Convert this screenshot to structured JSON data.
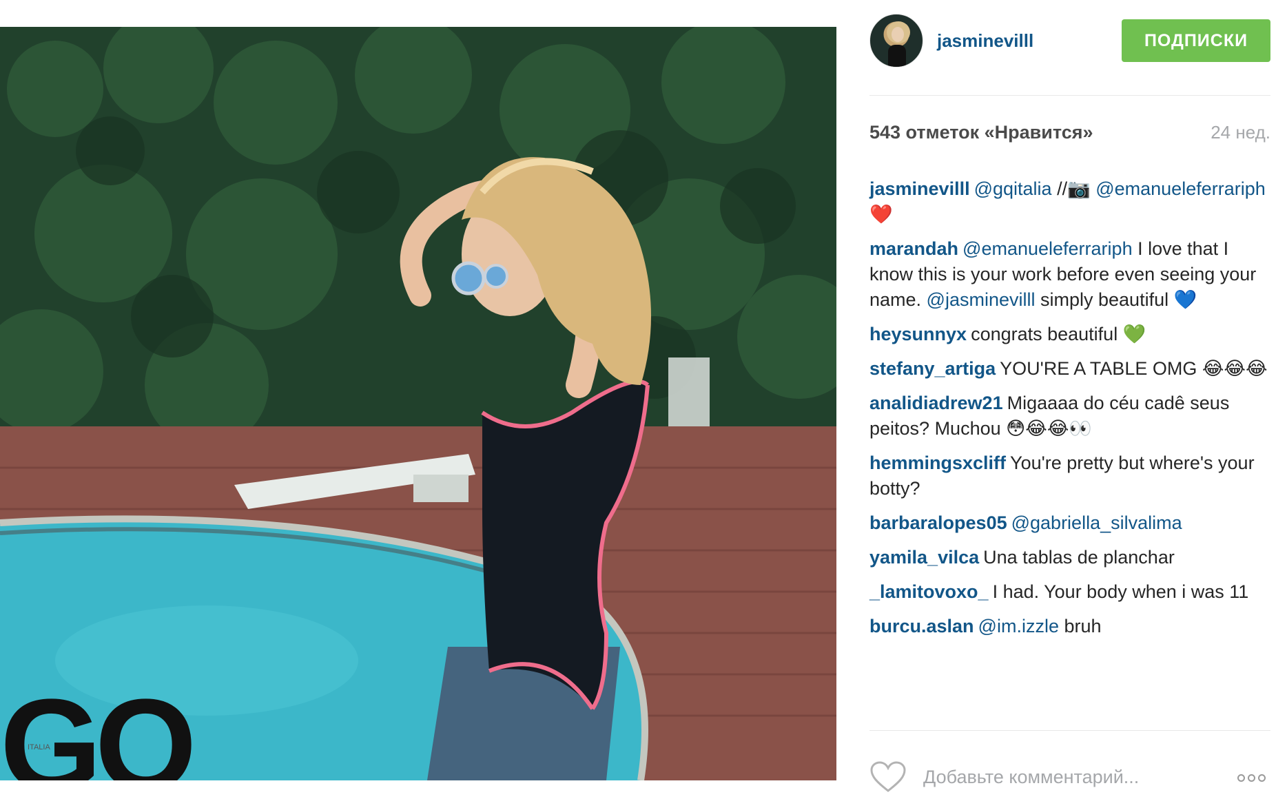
{
  "photo": {
    "alt_label": "Post photo",
    "logo_text": "GQ",
    "logo_small_text": "ITALIA"
  },
  "header": {
    "username": "jasminevilll",
    "follow_label": "ПОДПИСКИ",
    "follow_color": "#70c050",
    "link_color": "#125688"
  },
  "meta": {
    "likes": "543 отметок «Нравится»",
    "time": "24 нед."
  },
  "comments": [
    {
      "user": "jasminevilll",
      "parts": [
        {
          "t": "m",
          "v": "@gqitalia"
        },
        {
          "t": "x",
          "v": " //"
        },
        {
          "t": "e",
          "v": "📷"
        },
        {
          "t": "x",
          "v": " "
        },
        {
          "t": "m",
          "v": "@emanueleferrariph"
        },
        {
          "t": "x",
          "v": " "
        },
        {
          "t": "e",
          "v": "❤️"
        }
      ]
    },
    {
      "user": "marandah",
      "parts": [
        {
          "t": "m",
          "v": "@emanueleferrariph"
        },
        {
          "t": "x",
          "v": " I love that I know this is your work before even seeing your name. "
        },
        {
          "t": "m",
          "v": "@jasminevilll"
        },
        {
          "t": "x",
          "v": " simply beautiful "
        },
        {
          "t": "e",
          "v": "💙"
        }
      ]
    },
    {
      "user": "heysunnyx",
      "parts": [
        {
          "t": "x",
          "v": "congrats beautiful "
        },
        {
          "t": "e",
          "v": "💚"
        }
      ]
    },
    {
      "user": "stefany_artiga",
      "parts": [
        {
          "t": "x",
          "v": "YOU'RE A TABLE OMG "
        },
        {
          "t": "e",
          "v": "😂😂😂"
        }
      ]
    },
    {
      "user": "analidiadrew21",
      "parts": [
        {
          "t": "x",
          "v": "Migaaaa do céu cadê seus peitos? Muchou "
        },
        {
          "t": "e",
          "v": "😳😂😂👀"
        }
      ]
    },
    {
      "user": "hemmingsxcliff",
      "parts": [
        {
          "t": "x",
          "v": "You're pretty but where's your botty?"
        }
      ]
    },
    {
      "user": "barbaralopes05",
      "parts": [
        {
          "t": "m",
          "v": "@gabriella_silvalima"
        }
      ]
    },
    {
      "user": "yamila_vilca",
      "parts": [
        {
          "t": "x",
          "v": "Una tablas de planchar"
        }
      ]
    },
    {
      "user": "_lamitovoxo_",
      "parts": [
        {
          "t": "x",
          "v": "I had. Your body when i was 11"
        }
      ]
    },
    {
      "user": "burcu.aslan",
      "parts": [
        {
          "t": "m",
          "v": "@im.izzle"
        },
        {
          "t": "x",
          "v": " bruh"
        }
      ]
    }
  ],
  "footer": {
    "comment_placeholder": "Добавьте комментарий...",
    "like_icon": "heart-outline-icon",
    "more_icon": "more-options-icon"
  }
}
